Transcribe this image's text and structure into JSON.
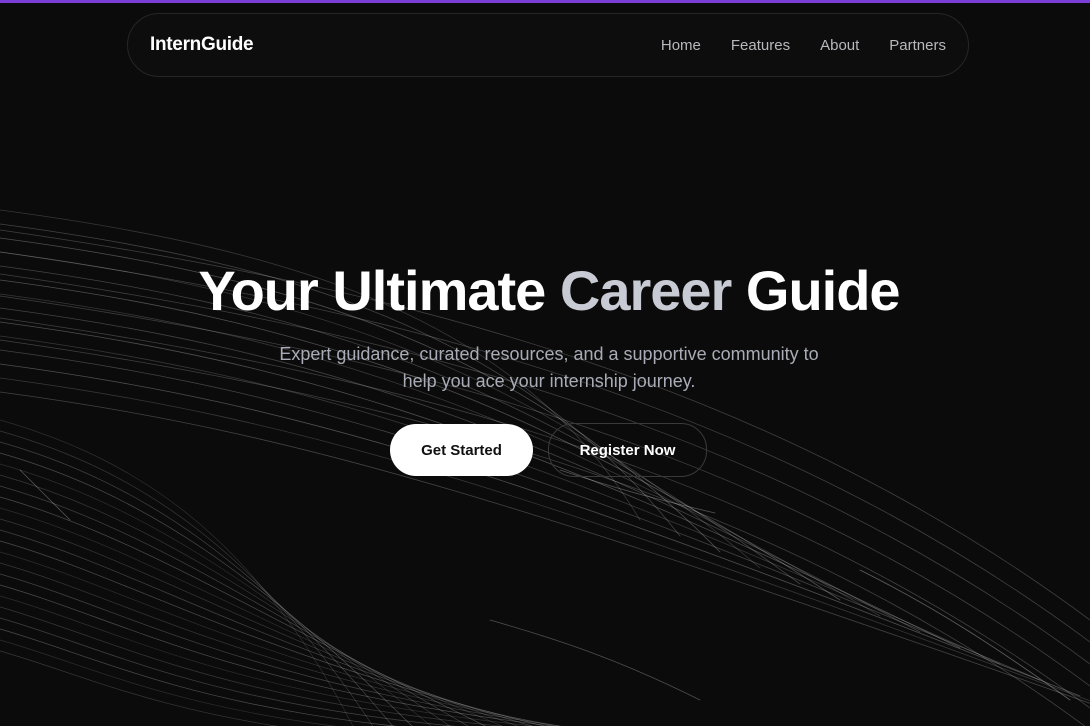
{
  "colors": {
    "background": "#0b0b0b",
    "top_accent": "#7b3fd8",
    "title_accent": "#c9cbd4",
    "subtitle": "#a9acb6",
    "nav_link": "#b8b8bd"
  },
  "navbar": {
    "brand": "InternGuide",
    "links": [
      "Home",
      "Features",
      "About",
      "Partners"
    ]
  },
  "hero": {
    "title_part1": "Your Ultimate ",
    "title_accent": "Career",
    "title_part2": " Guide",
    "subtitle_line1": "Expert guidance, curated resources, and a supportive community to",
    "subtitle_line2": "help you ace your internship journey."
  },
  "buttons": {
    "get_started": "Get Started",
    "register_now": "Register Now"
  }
}
